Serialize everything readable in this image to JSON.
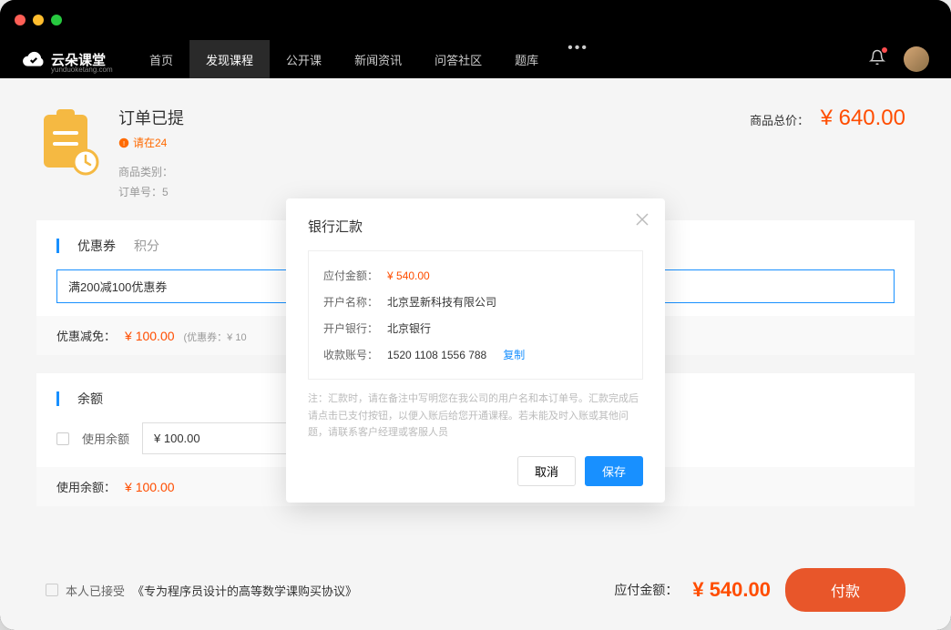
{
  "logo": {
    "text": "云朵课堂",
    "sub": "yunduoketang.com"
  },
  "nav": {
    "items": [
      {
        "label": "首页"
      },
      {
        "label": "发现课程"
      },
      {
        "label": "公开课"
      },
      {
        "label": "新闻资讯"
      },
      {
        "label": "问答社区"
      },
      {
        "label": "题库"
      }
    ],
    "more": "•••"
  },
  "order": {
    "title": "订单已提",
    "warn": "请在24",
    "meta_type_label": "商品类别：",
    "meta_no_label": "订单号：5",
    "total_label": "商品总价：",
    "total_price": "¥ 640.00"
  },
  "coupon": {
    "title": "优惠券",
    "tab": "积分",
    "input_value": "满200减100优惠券",
    "discount_label": "优惠减免：",
    "discount_amt": "¥ 100.00",
    "discount_note": "(优惠券：¥ 10"
  },
  "balance": {
    "title": "余额",
    "use_label": "使用余额",
    "input_value": "¥ 100.00",
    "used_label": "使用余额：",
    "used_amt": "¥ 100.00"
  },
  "footer": {
    "agree_prefix": "本人已接受",
    "agree_link": "《专为程序员设计的高等数学课购买协议》",
    "pay_label": "应付金额：",
    "pay_price": "¥ 540.00",
    "pay_btn": "付款"
  },
  "modal": {
    "title": "银行汇款",
    "rows": {
      "amount_label": "应付金额：",
      "amount_val": "¥ 540.00",
      "account_name_label": "开户名称：",
      "account_name_val": "北京昱新科技有限公司",
      "bank_label": "开户银行：",
      "bank_val": "北京银行",
      "account_no_label": "收款账号：",
      "account_no_val": "1520 1108 1556 788",
      "copy": "复制"
    },
    "note": "注：汇款时，请在备注中写明您在我公司的用户名和本订单号。汇款完成后请点击已支付按钮，以便入账后给您开通课程。若未能及时入账或其他问题，请联系客户经理或客服人员",
    "cancel": "取消",
    "save": "保存"
  }
}
